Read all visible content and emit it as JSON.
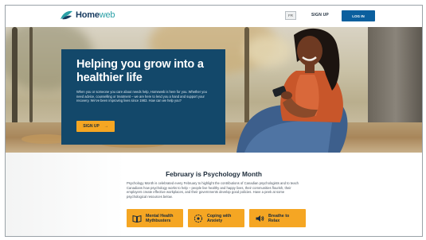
{
  "header": {
    "logo_text": "Home",
    "logo_text_light": "web",
    "lang_label": "FR",
    "signup_label": "SIGN UP",
    "login_label": "LOG IN"
  },
  "hero": {
    "title": "Helping you grow into a healthier life",
    "body": "When you or someone you care about needs help, Homeweb is here for you. Whether you need advice, counselling or treatment – we are here to lend you a hand and support your recovery. We’ve been improving lives since 1983. How can we help you?",
    "cta_label": "SIGN UP",
    "cta_arrow": "→"
  },
  "section": {
    "title": "February is Psychology Month",
    "body": "Psychology Month is celebrated every February to highlight the contributions of Canadian psychologists and to teach Canadians how psychology works to help – people live healthy and happy lives, their communities flourish, their employers create effective workplaces, and their governments develop good policies. Have a peek at some psychological resources below.",
    "resources": [
      {
        "icon": "book-icon",
        "label": "Mental Health\nMythbusters"
      },
      {
        "icon": "anxiety-icon",
        "label": "Coping with\nAnxiety"
      },
      {
        "icon": "speaker-icon",
        "label": "Breathe to\nRelax"
      }
    ]
  },
  "colors": {
    "brand_navy": "#13486a",
    "accent_orange": "#f5a623",
    "login_blue": "#0b5f9e",
    "logo_teal": "#2aa0a6"
  }
}
